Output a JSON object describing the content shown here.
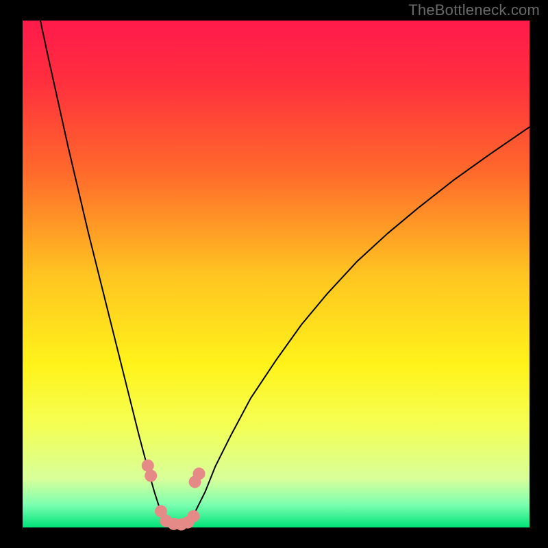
{
  "watermark": "TheBottleneck.com",
  "chart_data": {
    "type": "line",
    "title": "",
    "xlabel": "",
    "ylabel": "",
    "xlim": [
      0,
      100
    ],
    "ylim": [
      0,
      100
    ],
    "background_gradient": {
      "type": "vertical",
      "stops": [
        {
          "pos": 0.0,
          "color": "#ff1a4b"
        },
        {
          "pos": 0.12,
          "color": "#ff2f3e"
        },
        {
          "pos": 0.3,
          "color": "#ff6a2b"
        },
        {
          "pos": 0.5,
          "color": "#ffc421"
        },
        {
          "pos": 0.68,
          "color": "#fff31a"
        },
        {
          "pos": 0.8,
          "color": "#f4ff55"
        },
        {
          "pos": 0.905,
          "color": "#d7ff9a"
        },
        {
          "pos": 0.955,
          "color": "#7cffb0"
        },
        {
          "pos": 1.0,
          "color": "#00e37a"
        }
      ]
    },
    "series": [
      {
        "name": "left-curve",
        "color": "#000000",
        "stroke_width": 2,
        "x": [
          3.5,
          5,
          7,
          9,
          11,
          13,
          15,
          17,
          19,
          21,
          23,
          25,
          26,
          26.8,
          27.4,
          28,
          28.5
        ],
        "y": [
          100,
          93,
          84,
          75,
          66.5,
          58,
          50,
          42,
          34,
          26,
          18,
          10.5,
          7,
          4.5,
          3,
          1.8,
          1
        ]
      },
      {
        "name": "right-curve",
        "color": "#000000",
        "stroke_width": 2,
        "x": [
          33,
          34,
          36,
          38,
          41,
          45,
          50,
          55,
          60,
          66,
          72,
          78,
          85,
          92,
          100
        ],
        "y": [
          1,
          3,
          7,
          12,
          18,
          25.5,
          33,
          40,
          46,
          52.5,
          58,
          63,
          68.5,
          73.5,
          79
        ]
      },
      {
        "name": "valley-floor",
        "color": "#000000",
        "stroke_width": 2,
        "x": [
          28.5,
          30,
          31,
          32,
          33
        ],
        "y": [
          1,
          0.6,
          0.5,
          0.6,
          1
        ]
      }
    ],
    "markers": {
      "color": "#e58a86",
      "radius": 9,
      "points": [
        {
          "x": 24.7,
          "y": 12.2
        },
        {
          "x": 25.3,
          "y": 10.2
        },
        {
          "x": 27.3,
          "y": 3.2
        },
        {
          "x": 28.3,
          "y": 1.3
        },
        {
          "x": 29.8,
          "y": 0.7
        },
        {
          "x": 31.3,
          "y": 0.6
        },
        {
          "x": 32.6,
          "y": 1.0
        },
        {
          "x": 33.7,
          "y": 2.2
        },
        {
          "x": 34.0,
          "y": 9.0
        },
        {
          "x": 34.8,
          "y": 10.6
        }
      ]
    }
  }
}
